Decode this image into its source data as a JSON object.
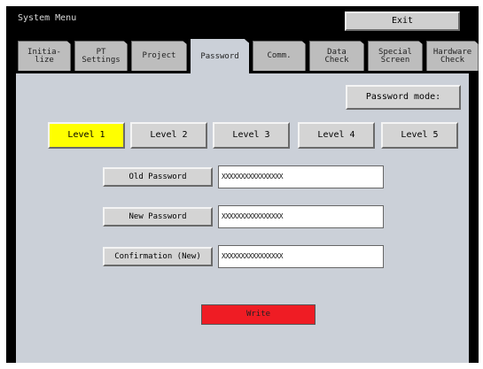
{
  "window": {
    "title": "System Menu",
    "exit_label": "Exit"
  },
  "tabs": [
    {
      "label": "Initia-\nlize"
    },
    {
      "label": "PT\nSettings"
    },
    {
      "label": "Project"
    },
    {
      "label": "Password",
      "active": true
    },
    {
      "label": "Comm."
    },
    {
      "label": "Data\nCheck"
    },
    {
      "label": "Special\nScreen"
    },
    {
      "label": "Hardware\nCheck"
    }
  ],
  "password_mode_label": "Password mode:",
  "levels": [
    {
      "label": "Level 1",
      "selected": true
    },
    {
      "label": "Level 2"
    },
    {
      "label": "Level 3"
    },
    {
      "label": "Level 4"
    },
    {
      "label": "Level 5"
    }
  ],
  "fields": {
    "old": {
      "label": "Old Password",
      "value": "XXXXXXXXXXXXXXXX"
    },
    "new": {
      "label": "New Password",
      "value": "XXXXXXXXXXXXXXXX"
    },
    "confirm": {
      "label": "Confirmation (New)",
      "value": "XXXXXXXXXXXXXXXX"
    }
  },
  "write_label": "Write",
  "colors": {
    "selected_level": "#ffff00",
    "write_button": "#ef1c24",
    "panel": "#cbd0d8"
  }
}
